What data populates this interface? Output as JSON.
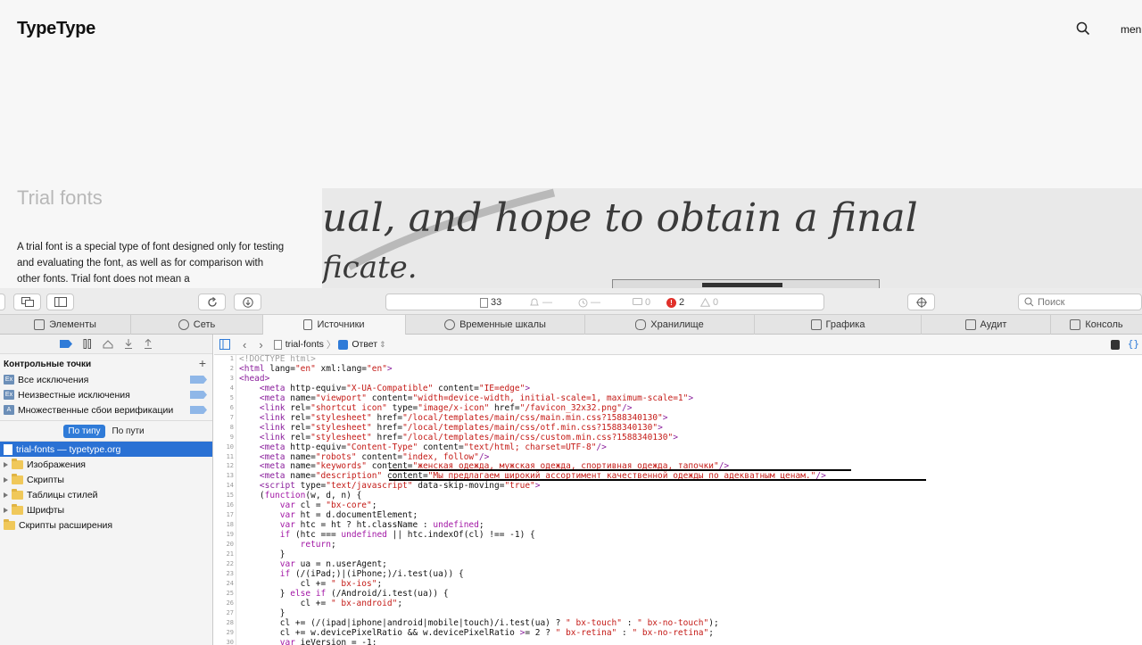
{
  "site": {
    "logo": "TypeType",
    "menu": "menu",
    "hero_title": "Trial fonts",
    "hero_text": "A trial font is a special type of font designed only for testing and evaluating the font, as well as for comparison with other fonts. Trial font does not mean a",
    "image_line1": "ual, and hope to obtain a final",
    "image_line2": "ficate."
  },
  "toolbar": {
    "resource_count": "33",
    "warn_dash": "—",
    "time_dash": "—",
    "log_count": "0",
    "error_count": "2",
    "warning_count": "0",
    "search_placeholder": "Поиск"
  },
  "tabs": [
    {
      "label": "Элементы",
      "icon": "elements-icon"
    },
    {
      "label": "Сеть",
      "icon": "network-icon"
    },
    {
      "label": "Источники",
      "icon": "sources-icon"
    },
    {
      "label": "Временные шкалы",
      "icon": "timelines-icon"
    },
    {
      "label": "Хранилище",
      "icon": "storage-icon"
    },
    {
      "label": "Графика",
      "icon": "graphics-icon"
    },
    {
      "label": "Аудит",
      "icon": "audit-icon"
    },
    {
      "label": "Консоль",
      "icon": "console-icon"
    }
  ],
  "sidebar": {
    "breakpoints_title": "Контрольные точки",
    "breakpoints": [
      {
        "label": "Все исключения",
        "badge": "Ex"
      },
      {
        "label": "Неизвестные исключения",
        "badge": "Ex"
      },
      {
        "label": "Множественные сбои верификации",
        "badge": "A"
      }
    ],
    "filter_by_type": "По типу",
    "filter_by_path": "По пути",
    "resources": [
      {
        "label": "trial-fonts — typetype.org",
        "selected": true,
        "kind": "document"
      },
      {
        "label": "Изображения",
        "kind": "folder",
        "expandable": true
      },
      {
        "label": "Скрипты",
        "kind": "folder",
        "expandable": true
      },
      {
        "label": "Таблицы стилей",
        "kind": "folder",
        "expandable": true
      },
      {
        "label": "Шрифты",
        "kind": "folder",
        "expandable": true
      },
      {
        "label": "Скрипты расширения",
        "kind": "folder",
        "expandable": false
      }
    ]
  },
  "editor": {
    "breadcrumb_file": "trial-fonts",
    "breadcrumb_mode": "Ответ"
  },
  "code_lines": [
    "<!DOCTYPE html>",
    "<html lang=\"en\" xml:lang=\"en\">",
    "<head>",
    "    <meta http-equiv=\"X-UA-Compatible\" content=\"IE=edge\">",
    "    <meta name=\"viewport\" content=\"width=device-width, initial-scale=1, maximum-scale=1\">",
    "    <link rel=\"shortcut icon\" type=\"image/x-icon\" href=\"/favicon_32x32.png\"/>",
    "    <link rel=\"stylesheet\" href=\"/local/templates/main/css/main.min.css?1588340130\">",
    "    <link rel=\"stylesheet\" href=\"/local/templates/main/css/otf.min.css?1588340130\">",
    "    <link rel=\"stylesheet\" href=\"/local/templates/main/css/custom.min.css?1588340130\">",
    "    <meta http-equiv=\"Content-Type\" content=\"text/html; charset=UTF-8\"/>",
    "    <meta name=\"robots\" content=\"index, follow\"/>",
    "    <meta name=\"keywords\" content=\"женская одежда, мужская одежда, спортивная одежда, тапочки\"/>",
    "    <meta name=\"description\" content=\"Мы предлагаем широкий ассортимент качественной одежды по адекватным ценам.\"/>",
    "    <script type=\"text/javascript\" data-skip-moving=\"true\">",
    "    (function(w, d, n) {",
    "        var cl = \"bx-core\";",
    "        var ht = d.documentElement;",
    "        var htc = ht ? ht.className : undefined;",
    "        if (htc === undefined || htc.indexOf(cl) !== -1) {",
    "            return;",
    "        }",
    "        var ua = n.userAgent;",
    "        if (/(iPad;)|(iPhone;)/i.test(ua)) {",
    "            cl += \" bx-ios\";",
    "        } else if (/Android/i.test(ua)) {",
    "            cl += \" bx-android\";",
    "        }",
    "        cl += (/(ipad|iphone|android|mobile|touch)/i.test(ua) ? \" bx-touch\" : \" bx-no-touch\");",
    "        cl += w.devicePixelRatio && w.devicePixelRatio >= 2 ? \" bx-retina\" : \" bx-no-retina\";",
    "        var ieVersion = -1;"
  ]
}
